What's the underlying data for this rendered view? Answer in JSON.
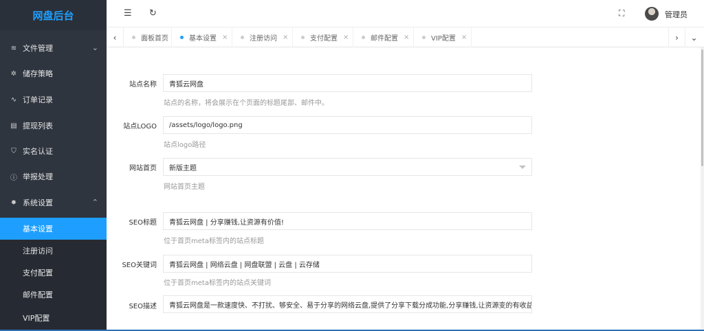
{
  "sidebar": {
    "logo": "网盘后台",
    "items": [
      {
        "icon": "≋",
        "icon_name": "layers-icon",
        "label": "文件管理",
        "arrow": "⌄"
      },
      {
        "icon": "✲",
        "icon_name": "storage-policy-icon",
        "label": "储存策略"
      },
      {
        "icon": "∿",
        "icon_name": "pulse-icon",
        "label": "订单记录"
      },
      {
        "icon": "▤",
        "icon_name": "list-icon",
        "label": "提现列表"
      },
      {
        "icon": "⛉",
        "icon_name": "shield-icon",
        "label": "实名认证"
      },
      {
        "icon": "ⓘ",
        "icon_name": "info-icon",
        "label": "举报处理"
      },
      {
        "icon": "✸",
        "icon_name": "gear-icon",
        "label": "系统设置",
        "arrow": "⌃"
      }
    ],
    "sub_items": [
      "基本设置",
      "注册访问",
      "支付配置",
      "邮件配置",
      "VIP配置"
    ]
  },
  "topbar": {
    "fold_icon": "☰",
    "refresh_icon": "↻",
    "fullscreen_icon": "⛶",
    "admin_name": "管理员"
  },
  "tabs": {
    "prev": "‹",
    "next": "›",
    "more": "⌄",
    "items": [
      {
        "label": "面板首页",
        "closable": false
      },
      {
        "label": "基本设置",
        "closable": true,
        "active": true
      },
      {
        "label": "注册访问",
        "closable": true
      },
      {
        "label": "支付配置",
        "closable": true
      },
      {
        "label": "邮件配置",
        "closable": true
      },
      {
        "label": "VIP配置",
        "closable": true
      }
    ],
    "close_glyph": "×"
  },
  "form": {
    "site_name": {
      "label": "站点名称",
      "value": "青狐云网盘",
      "help": "站点的名称，将会展示在个页面的标题尾部、邮件中。"
    },
    "site_logo": {
      "label": "站点LOGO",
      "value": "/assets/logo/logo.png",
      "help": "站点logo路径"
    },
    "homepage": {
      "label": "网站首页",
      "value": "新版主题",
      "help": "网站首页主题"
    },
    "seo_title": {
      "label": "SEO标题",
      "value": "青狐云网盘 | 分享赚钱,让资源有价值!",
      "help": "位于首页meta标签内的站点标题"
    },
    "seo_keywords": {
      "label": "SEO关键词",
      "value": "青狐云网盘 | 网络云盘 | 网盘联盟 | 云盘 | 云存储",
      "help": "位于首页meta标签内的站点关键词"
    },
    "seo_desc": {
      "label": "SEO描述",
      "value": "青狐云网盘是一款速度快、不打扰、够安全、易于分享的网络云盘,提供了分享下载分成功能,分享赚钱,让资源变的有收益有价"
    }
  },
  "colors": {
    "accent": "#1e9fff",
    "sidebar_bg": "#2f353f"
  }
}
